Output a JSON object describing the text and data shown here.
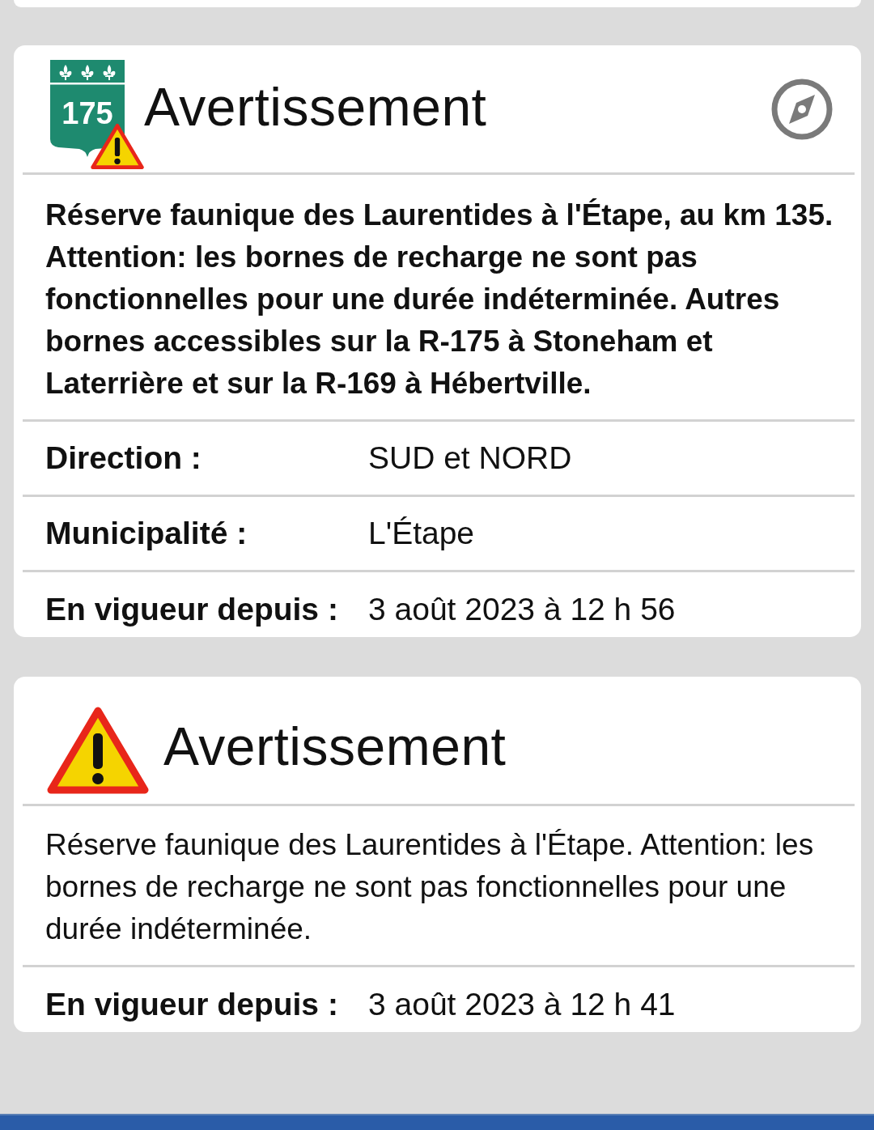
{
  "alerts": [
    {
      "icon": {
        "kind": "route",
        "route_number": "175"
      },
      "title": "Avertissement",
      "locate_button": true,
      "description": "Réserve faunique des Laurentides à l'Étape, au km 135. Attention: les bornes de recharge ne sont pas fonctionnelles pour une durée indéterminée. Autres bornes accessibles sur la R-175 à Stoneham et Laterrière et sur la R-169 à Hébertville.",
      "description_bold": true,
      "fields": [
        {
          "label": "Direction :",
          "value": "SUD et NORD"
        },
        {
          "label": "Municipalité :",
          "value": "L'Étape"
        },
        {
          "label": "En vigueur depuis :",
          "value": "3 août 2023 à 12 h 56"
        }
      ]
    },
    {
      "icon": {
        "kind": "warning"
      },
      "title": "Avertissement",
      "locate_button": false,
      "description": "Réserve faunique des Laurentides à l'Étape. Attention: les bornes de recharge ne sont pas fonctionnelles pour une durée indéterminée.",
      "description_bold": false,
      "fields": [
        {
          "label": "En vigueur depuis :",
          "value": "3 août 2023 à 12 h 41"
        }
      ]
    }
  ]
}
